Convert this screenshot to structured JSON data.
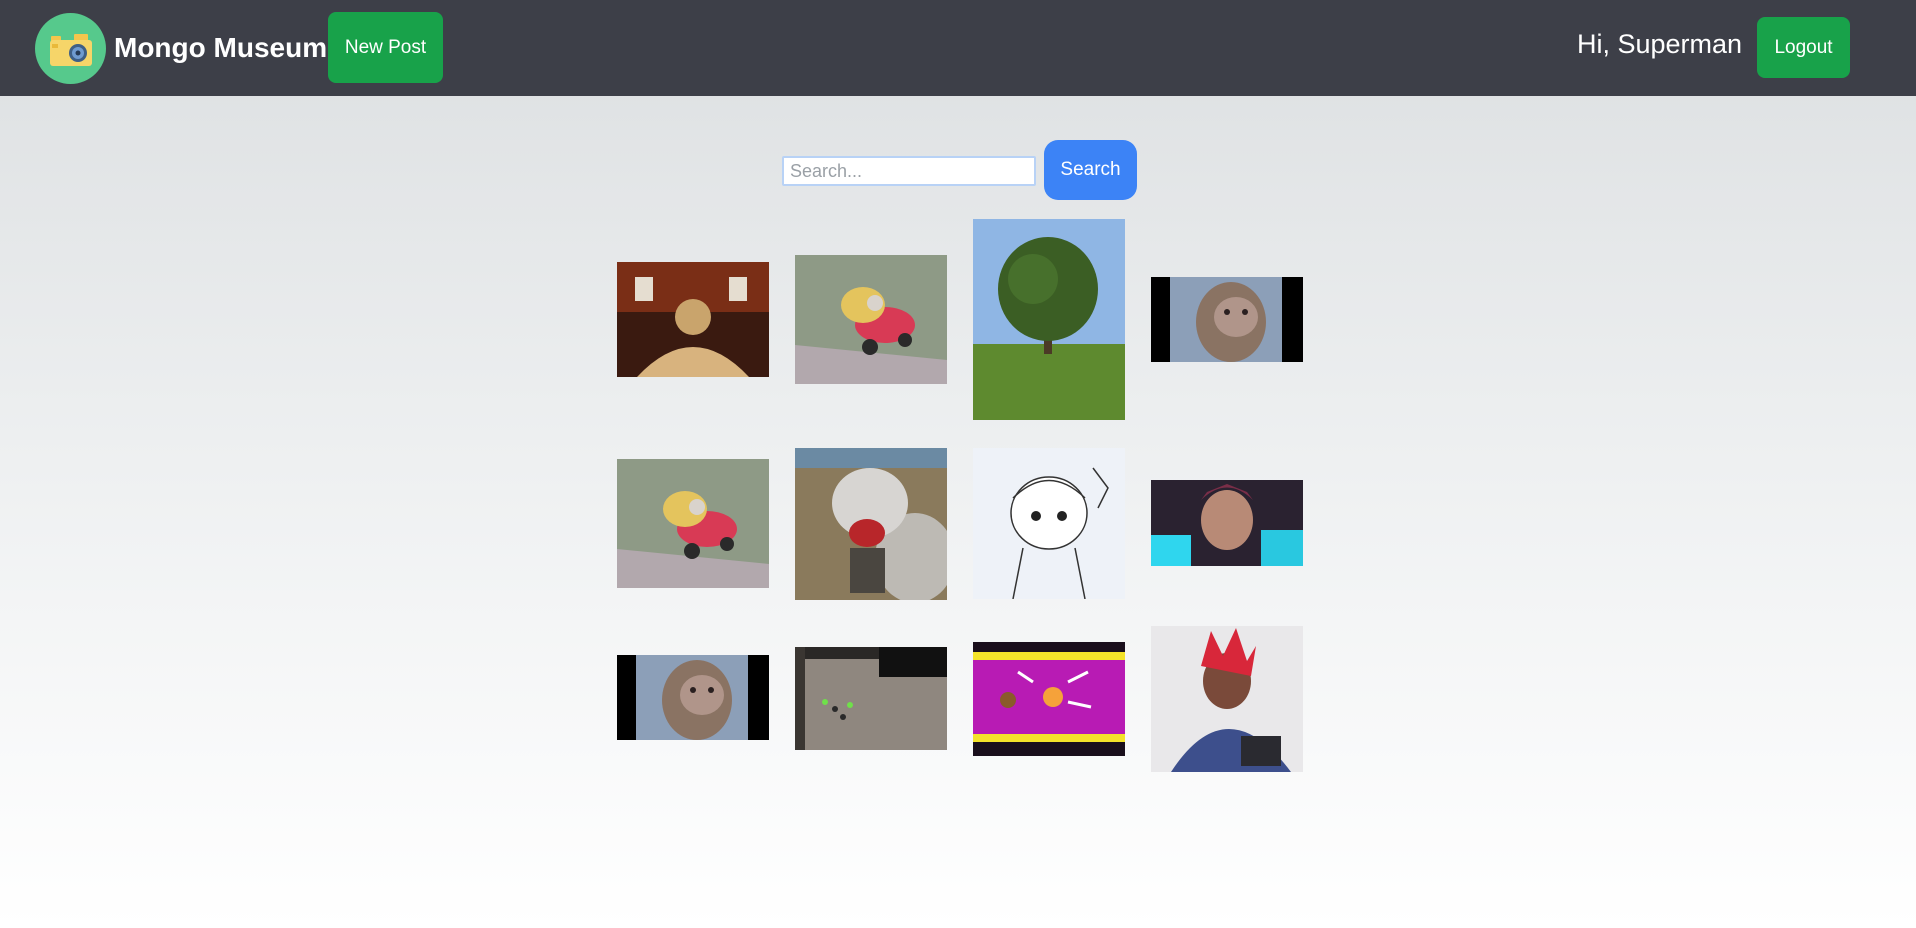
{
  "header": {
    "brand": "Mongo Museum",
    "new_post_label": "New Post",
    "greeting": "Hi, Superman",
    "logout_label": "Logout",
    "logo_icon": "camera-icon"
  },
  "search": {
    "placeholder": "Search...",
    "value": "",
    "button_label": "Search"
  },
  "gallery": {
    "posts": [
      {
        "image": "cartoon-warrior-with-banners"
      },
      {
        "image": "toddler-in-pink-toy-car"
      },
      {
        "image": "tree-in-field"
      },
      {
        "image": "monkey-closeup"
      },
      {
        "image": "toddler-in-pink-toy-car"
      },
      {
        "image": "anime-gray-haired-warrior"
      },
      {
        "image": "anime-girl-sketch"
      },
      {
        "image": "anime-character-cockpit"
      },
      {
        "image": "monkey-closeup"
      },
      {
        "image": "pixel-game-map"
      },
      {
        "image": "pink-pixel-stage"
      },
      {
        "image": "red-haired-anime-man"
      }
    ]
  },
  "colors": {
    "navbar": "#3d3f48",
    "green_button": "#18a24a",
    "search_button": "#3c83f6",
    "logo_circle": "#56c98c"
  }
}
